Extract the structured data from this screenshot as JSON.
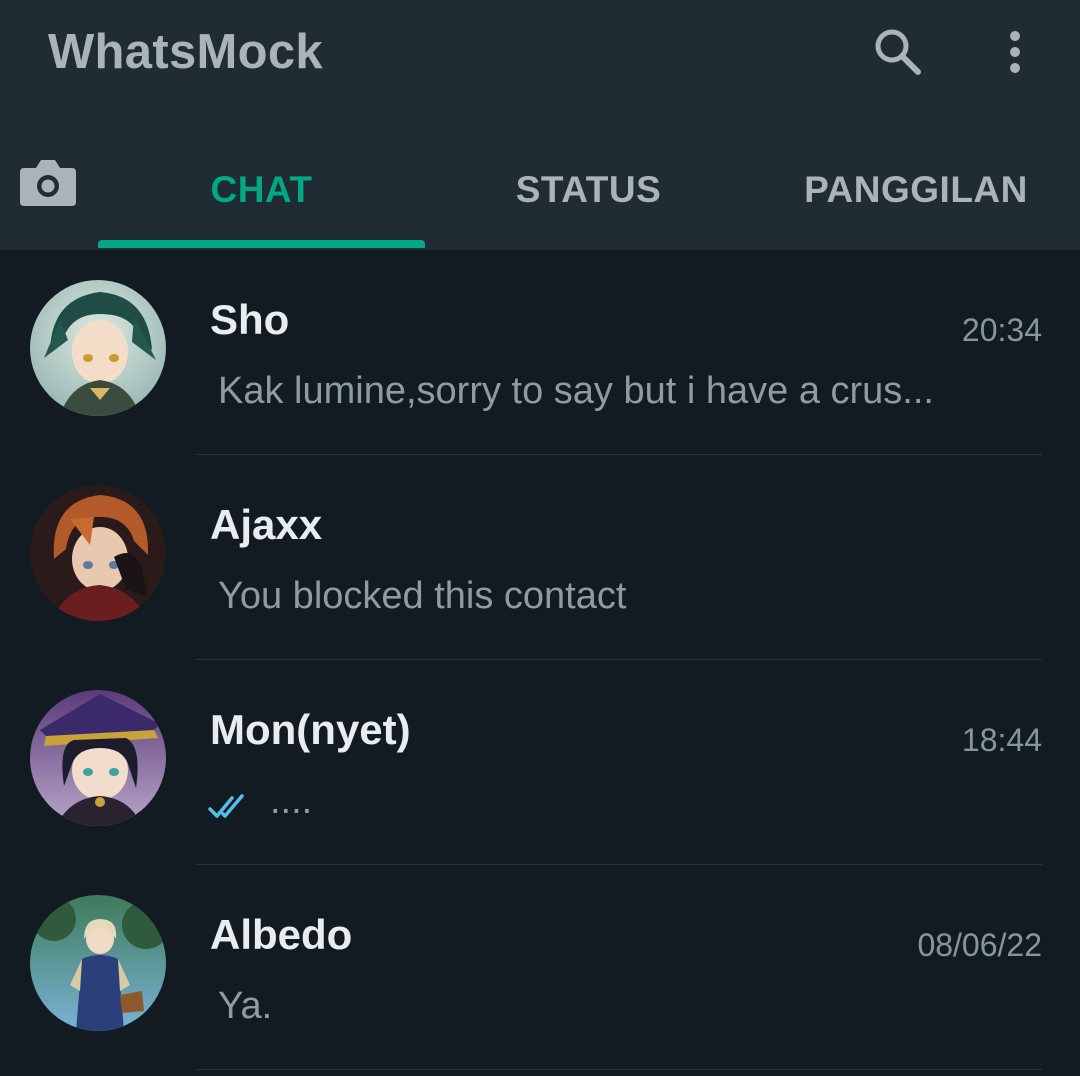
{
  "app": {
    "title": "WhatsMock"
  },
  "header": {
    "icons": [
      "search-icon",
      "more-vertical-icon"
    ]
  },
  "tabs": [
    {
      "label": "CHAT",
      "active": true
    },
    {
      "label": "STATUS",
      "active": false
    },
    {
      "label": "PANGGILAN",
      "active": false
    }
  ],
  "colors": {
    "accent": "#00a884",
    "header_bg": "#202c33",
    "list_bg": "#121b22",
    "read_tick": "#53bdeb"
  },
  "chats": [
    {
      "name": "Sho",
      "time": "20:34",
      "preview": "Kak lumine,sorry to say but i have a crus..."
    },
    {
      "name": "Ajaxx",
      "time": "",
      "preview": "You blocked this contact"
    },
    {
      "name": "Mon(nyet)",
      "time": "18:44",
      "preview": "....",
      "status_icon": "double-check-read-icon"
    },
    {
      "name": "Albedo",
      "time": "08/06/22",
      "preview": "Ya."
    }
  ]
}
